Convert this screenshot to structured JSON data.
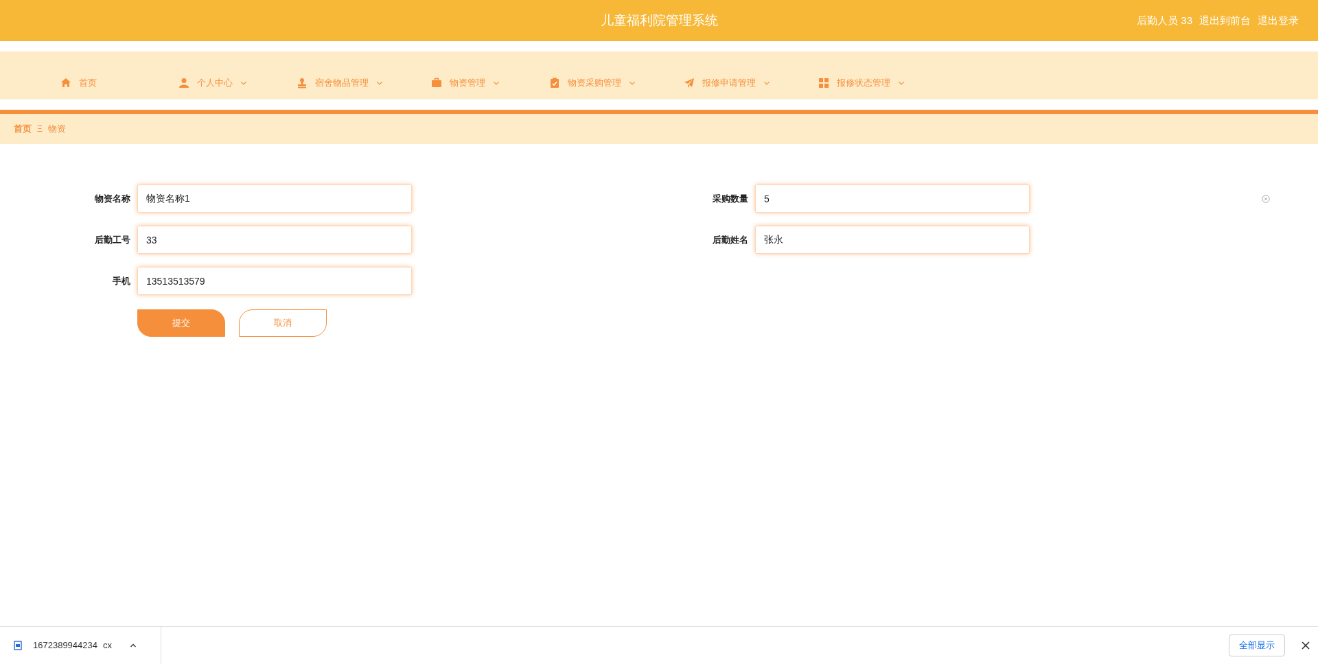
{
  "header": {
    "title": "儿童福利院管理系统",
    "user_label": "后勤人员 33",
    "links": [
      "退出到前台",
      "退出登录"
    ]
  },
  "nav": [
    {
      "label": "首页",
      "kind": "home",
      "has_menu": false
    },
    {
      "label": "个人中心",
      "kind": "person",
      "has_menu": true
    },
    {
      "label": "宿舍物品管理",
      "kind": "stamp",
      "has_menu": true
    },
    {
      "label": "物资管理",
      "kind": "briefcase",
      "has_menu": true
    },
    {
      "label": "物资采购管理",
      "kind": "clipboard",
      "has_menu": true
    },
    {
      "label": "报修申请管理",
      "kind": "plane",
      "has_menu": true
    },
    {
      "label": "报修状态管理",
      "kind": "grid",
      "has_menu": true
    }
  ],
  "breadcrumb": {
    "items": [
      "首页",
      "物资"
    ],
    "separator": "Ξ"
  },
  "form": {
    "left": [
      {
        "label": "物资名称",
        "value": "物资名称1"
      },
      {
        "label": "后勤工号",
        "value": "33"
      },
      {
        "label": "手机",
        "value": "13513513579"
      }
    ],
    "right": [
      {
        "label": "采购数量",
        "value": "5",
        "clearable": true
      },
      {
        "label": "后勤姓名",
        "value": "张永",
        "clearable": false
      }
    ],
    "buttons": [
      {
        "label": "提交",
        "kind": "primary"
      },
      {
        "label": "取消",
        "kind": "secondary"
      }
    ]
  },
  "download_bar": {
    "file": "1672389944234",
    "file_end": "cx",
    "show_all": "全部显示"
  }
}
